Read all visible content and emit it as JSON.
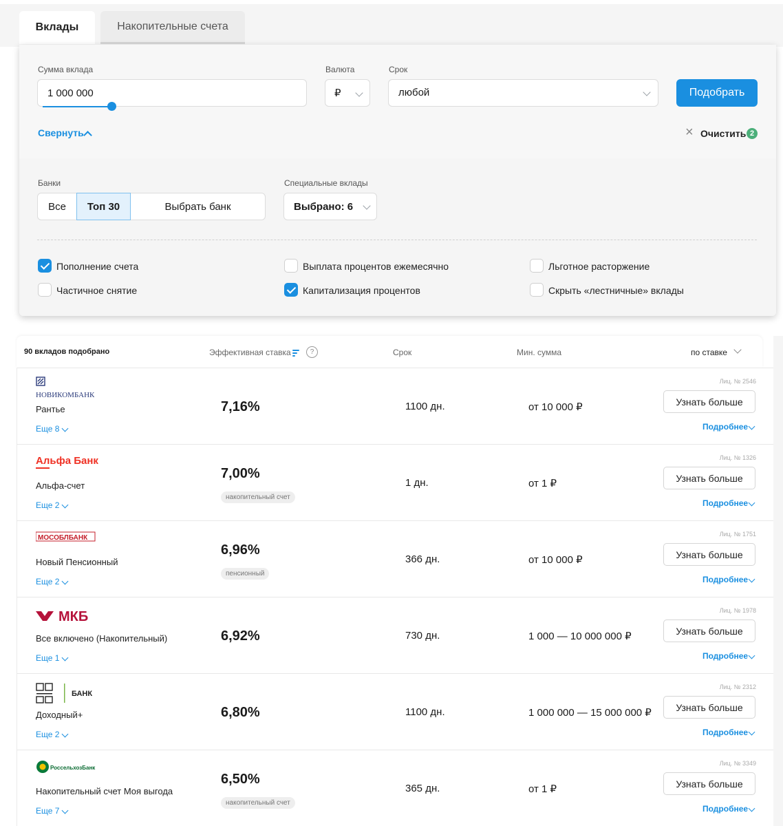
{
  "tabs": {
    "deposits": "Вклады",
    "savings": "Накопительные счета"
  },
  "filters": {
    "amount_label": "Сумма вклада",
    "amount_value": "1 000 000",
    "currency_label": "Валюта",
    "currency_value": "₽",
    "term_label": "Срок",
    "term_value": "любой",
    "submit": "Подобрать",
    "collapse": "Свернуть",
    "clear": "Очистить",
    "clear_count": "2",
    "banks_label": "Банки",
    "banks_all": "Все",
    "banks_top": "Топ 30",
    "banks_choose": "Выбрать банк",
    "special_label": "Специальные вклады",
    "special_value": "Выбрано: 6",
    "options": [
      {
        "label": "Пополнение счета",
        "checked": true
      },
      {
        "label": "Выплата процентов ежемесячно",
        "checked": false
      },
      {
        "label": "Льготное расторжение",
        "checked": false
      },
      {
        "label": "Частичное снятие",
        "checked": false
      },
      {
        "label": "Капитализация процентов",
        "checked": true
      },
      {
        "label": "Скрыть «лестничные» вклады",
        "checked": false
      }
    ]
  },
  "results": {
    "count": "90 вкладов подобрано",
    "col_rate": "Эффективная ставка",
    "help": "?",
    "col_term": "Срок",
    "col_min": "Мин. сумма",
    "sort": "по ставке",
    "btn_label": "Узнать больше",
    "details_label": "Подробнее",
    "rows": [
      {
        "bank": "НОВИКОМБАНК",
        "name": "Рантье",
        "rate": "7,16%",
        "tag": "",
        "term": "1100 дн.",
        "min": "от 10 000 ₽",
        "lic": "Лиц. № 2546",
        "more": "Еще 8"
      },
      {
        "bank": "Альфа Банк",
        "name": "Альфа-счет",
        "rate": "7,00%",
        "tag": "накопительный счет",
        "term": "1 дн.",
        "min": "от 1 ₽",
        "lic": "Лиц. № 1326",
        "more": "Еще 2"
      },
      {
        "bank": "МОСОБЛБАНК",
        "name": "Новый Пенсионный",
        "rate": "6,96%",
        "tag": "пенсионный",
        "term": "366 дн.",
        "min": "от 10 000 ₽",
        "lic": "Лиц. № 1751",
        "more": "Еще 2"
      },
      {
        "bank": "МКБ",
        "name": "Все включено (Накопительный)",
        "rate": "6,92%",
        "tag": "",
        "term": "730 дн.",
        "min": "1 000 — 10 000 000 ₽",
        "lic": "Лиц. № 1978",
        "more": "Еще 1"
      },
      {
        "bank": "БАНК",
        "name": "Доходный+",
        "rate": "6,80%",
        "tag": "",
        "term": "1100 дн.",
        "min": "1 000 000 — 15 000 000 ₽",
        "lic": "Лиц. № 2312",
        "more": "Еще 2"
      },
      {
        "bank": "РоссельхозБанк",
        "name": "Накопительный счет Моя выгода",
        "rate": "6,50%",
        "tag": "накопительный счет",
        "term": "365 дн.",
        "min": "от 1 ₽",
        "lic": "Лиц. № 3349",
        "more": "Еще 7"
      }
    ]
  }
}
